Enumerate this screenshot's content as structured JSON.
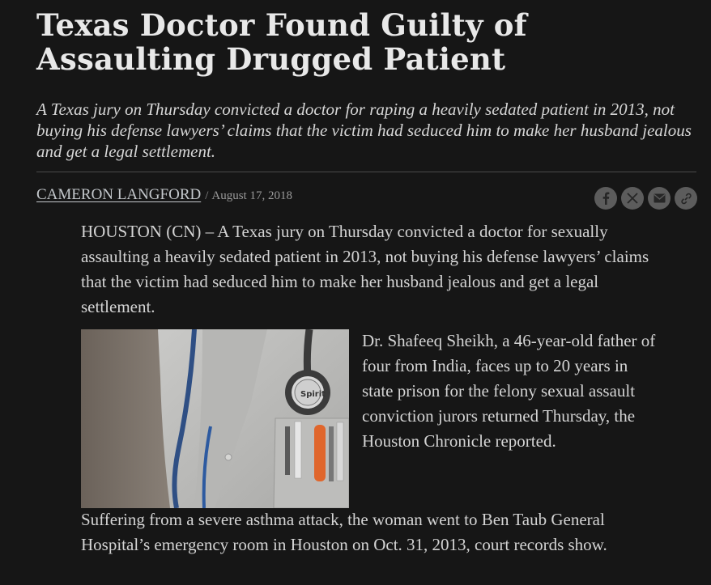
{
  "article": {
    "headline": "Texas Doctor Found Guilty of Assaulting Drugged Patient",
    "dek": "A Texas jury on Thursday convicted a doctor for raping a heavily sedated patient in 2013, not buying his defense lawyers’ claims that the victim had seduced him to make her husband jealous and get a legal settlement.",
    "author": "CAMERON LANGFORD",
    "byline_separator": "/",
    "date": "August 17, 2018",
    "share_icons": [
      "facebook-icon",
      "x-icon",
      "email-icon",
      "link-icon"
    ],
    "paragraphs": [
      "HOUSTON (CN) – A Texas jury on Thursday convicted a doctor for sexually assaulting a heavily sedated patient in 2013, not buying his defense lawyers’ claims that the victim had seduced him to make her husband jealous and get a legal settlement.",
      "Dr. Shafeeq Sheikh, a 46-year-old father of four from India, faces up to 20 years in state prison for the felony sexual assault conviction jurors returned Thursday, the Houston Chronicle reported.",
      "Suffering from a severe asthma attack, the woman went to Ben Taub General Hospital’s emergency room in Houston on Oct. 31, 2013, court records show."
    ],
    "photo_stethoscope_text": "Spirit"
  }
}
